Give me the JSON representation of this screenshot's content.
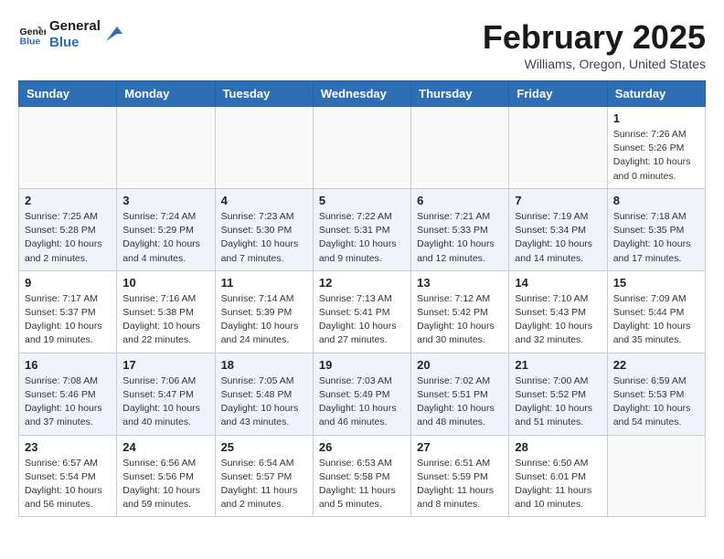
{
  "header": {
    "logo_line1": "General",
    "logo_line2": "Blue",
    "month": "February 2025",
    "location": "Williams, Oregon, United States"
  },
  "weekdays": [
    "Sunday",
    "Monday",
    "Tuesday",
    "Wednesday",
    "Thursday",
    "Friday",
    "Saturday"
  ],
  "weeks": [
    [
      {
        "day": "",
        "info": ""
      },
      {
        "day": "",
        "info": ""
      },
      {
        "day": "",
        "info": ""
      },
      {
        "day": "",
        "info": ""
      },
      {
        "day": "",
        "info": ""
      },
      {
        "day": "",
        "info": ""
      },
      {
        "day": "1",
        "info": "Sunrise: 7:26 AM\nSunset: 5:26 PM\nDaylight: 10 hours and 0 minutes."
      }
    ],
    [
      {
        "day": "2",
        "info": "Sunrise: 7:25 AM\nSunset: 5:28 PM\nDaylight: 10 hours and 2 minutes."
      },
      {
        "day": "3",
        "info": "Sunrise: 7:24 AM\nSunset: 5:29 PM\nDaylight: 10 hours and 4 minutes."
      },
      {
        "day": "4",
        "info": "Sunrise: 7:23 AM\nSunset: 5:30 PM\nDaylight: 10 hours and 7 minutes."
      },
      {
        "day": "5",
        "info": "Sunrise: 7:22 AM\nSunset: 5:31 PM\nDaylight: 10 hours and 9 minutes."
      },
      {
        "day": "6",
        "info": "Sunrise: 7:21 AM\nSunset: 5:33 PM\nDaylight: 10 hours and 12 minutes."
      },
      {
        "day": "7",
        "info": "Sunrise: 7:19 AM\nSunset: 5:34 PM\nDaylight: 10 hours and 14 minutes."
      },
      {
        "day": "8",
        "info": "Sunrise: 7:18 AM\nSunset: 5:35 PM\nDaylight: 10 hours and 17 minutes."
      }
    ],
    [
      {
        "day": "9",
        "info": "Sunrise: 7:17 AM\nSunset: 5:37 PM\nDaylight: 10 hours and 19 minutes."
      },
      {
        "day": "10",
        "info": "Sunrise: 7:16 AM\nSunset: 5:38 PM\nDaylight: 10 hours and 22 minutes."
      },
      {
        "day": "11",
        "info": "Sunrise: 7:14 AM\nSunset: 5:39 PM\nDaylight: 10 hours and 24 minutes."
      },
      {
        "day": "12",
        "info": "Sunrise: 7:13 AM\nSunset: 5:41 PM\nDaylight: 10 hours and 27 minutes."
      },
      {
        "day": "13",
        "info": "Sunrise: 7:12 AM\nSunset: 5:42 PM\nDaylight: 10 hours and 30 minutes."
      },
      {
        "day": "14",
        "info": "Sunrise: 7:10 AM\nSunset: 5:43 PM\nDaylight: 10 hours and 32 minutes."
      },
      {
        "day": "15",
        "info": "Sunrise: 7:09 AM\nSunset: 5:44 PM\nDaylight: 10 hours and 35 minutes."
      }
    ],
    [
      {
        "day": "16",
        "info": "Sunrise: 7:08 AM\nSunset: 5:46 PM\nDaylight: 10 hours and 37 minutes."
      },
      {
        "day": "17",
        "info": "Sunrise: 7:06 AM\nSunset: 5:47 PM\nDaylight: 10 hours and 40 minutes."
      },
      {
        "day": "18",
        "info": "Sunrise: 7:05 AM\nSunset: 5:48 PM\nDaylight: 10 hours and 43 minutes."
      },
      {
        "day": "19",
        "info": "Sunrise: 7:03 AM\nSunset: 5:49 PM\nDaylight: 10 hours and 46 minutes."
      },
      {
        "day": "20",
        "info": "Sunrise: 7:02 AM\nSunset: 5:51 PM\nDaylight: 10 hours and 48 minutes."
      },
      {
        "day": "21",
        "info": "Sunrise: 7:00 AM\nSunset: 5:52 PM\nDaylight: 10 hours and 51 minutes."
      },
      {
        "day": "22",
        "info": "Sunrise: 6:59 AM\nSunset: 5:53 PM\nDaylight: 10 hours and 54 minutes."
      }
    ],
    [
      {
        "day": "23",
        "info": "Sunrise: 6:57 AM\nSunset: 5:54 PM\nDaylight: 10 hours and 56 minutes."
      },
      {
        "day": "24",
        "info": "Sunrise: 6:56 AM\nSunset: 5:56 PM\nDaylight: 10 hours and 59 minutes."
      },
      {
        "day": "25",
        "info": "Sunrise: 6:54 AM\nSunset: 5:57 PM\nDaylight: 11 hours and 2 minutes."
      },
      {
        "day": "26",
        "info": "Sunrise: 6:53 AM\nSunset: 5:58 PM\nDaylight: 11 hours and 5 minutes."
      },
      {
        "day": "27",
        "info": "Sunrise: 6:51 AM\nSunset: 5:59 PM\nDaylight: 11 hours and 8 minutes."
      },
      {
        "day": "28",
        "info": "Sunrise: 6:50 AM\nSunset: 6:01 PM\nDaylight: 11 hours and 10 minutes."
      },
      {
        "day": "",
        "info": ""
      }
    ]
  ]
}
